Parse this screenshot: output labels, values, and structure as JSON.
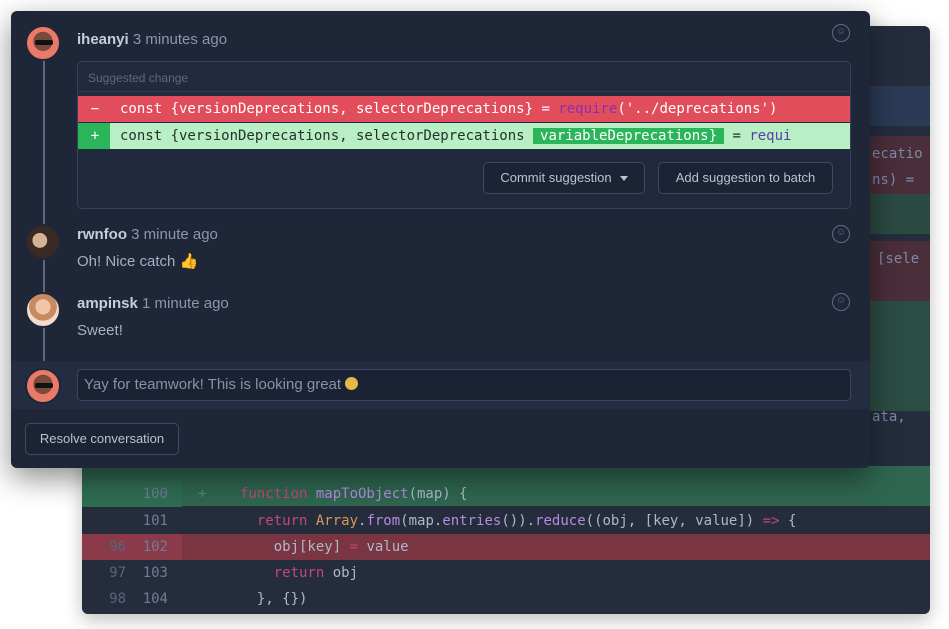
{
  "code_panel": {
    "right_snippets": [
      "ecatio",
      "ns) =",
      "[sele",
      "ata,"
    ],
    "lines": [
      {
        "old": "",
        "new": "100",
        "mark": "+",
        "type": "add",
        "tokens": [
          {
            "t": "function ",
            "c": "kw"
          },
          {
            "t": "mapToObject",
            "c": "fn"
          },
          {
            "t": "(map) {",
            "c": "prm"
          }
        ]
      },
      {
        "old": "",
        "new": "101",
        "mark": "",
        "type": "ctx",
        "tokens": [
          {
            "t": "  return ",
            "c": "kw"
          },
          {
            "t": "Array",
            "c": "cls"
          },
          {
            "t": ".",
            "c": "prm"
          },
          {
            "t": "from",
            "c": "fn"
          },
          {
            "t": "(map.",
            "c": "prm"
          },
          {
            "t": "entries",
            "c": "fn"
          },
          {
            "t": "()).",
            "c": "prm"
          },
          {
            "t": "reduce",
            "c": "fn"
          },
          {
            "t": "((obj, [key, value]) ",
            "c": "prm"
          },
          {
            "t": "=>",
            "c": "kw"
          },
          {
            "t": " {",
            "c": "prm"
          }
        ]
      },
      {
        "old": "96",
        "new": "102",
        "mark": "",
        "type": "del",
        "tokens": [
          {
            "t": "    obj[key] ",
            "c": "prm"
          },
          {
            "t": "=",
            "c": "kw"
          },
          {
            "t": " value",
            "c": "prm"
          }
        ]
      },
      {
        "old": "97",
        "new": "103",
        "mark": "",
        "type": "ctx",
        "tokens": [
          {
            "t": "    return ",
            "c": "kw"
          },
          {
            "t": "obj",
            "c": "prm"
          }
        ]
      },
      {
        "old": "98",
        "new": "104",
        "mark": "",
        "type": "ctx",
        "tokens": [
          {
            "t": "  }, {})",
            "c": "prm"
          }
        ]
      }
    ]
  },
  "conversation": {
    "comment_1": {
      "author": "iheanyi",
      "time": "3 minutes ago"
    },
    "suggested_change": {
      "header": "Suggested change",
      "deleted": {
        "sign": "−",
        "code": "const {versionDeprecations, selectorDeprecations} ",
        "eq": "= ",
        "req": "require",
        "rest": "('../deprecations')"
      },
      "added": {
        "sign": "+",
        "code": "const {versionDeprecations, selectorDeprecations ",
        "highlight": "variableDeprecations}",
        "eq": " = ",
        "req": "requi"
      },
      "commit_label": "Commit suggestion",
      "batch_label": "Add suggestion to batch"
    },
    "comment_2": {
      "author": "rwnfoo",
      "time": "3 minute ago",
      "body": "Oh! Nice catch 👍"
    },
    "comment_3": {
      "author": "ampinsk",
      "time": "1 minute ago",
      "body": "Sweet!"
    },
    "reply": {
      "value": "Yay for teamwork! This is looking great"
    },
    "resolve_label": "Resolve conversation"
  },
  "icons": {
    "emoji_reaction": "smiley-icon"
  }
}
